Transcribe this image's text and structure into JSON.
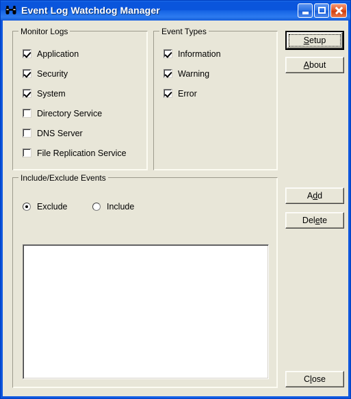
{
  "window": {
    "title": "Event Log Watchdog Manager",
    "icon": "binoculars-icon",
    "caption_buttons": {
      "minimize": "minimize-icon",
      "maximize": "maximize-icon",
      "close": "close-icon"
    },
    "colors": {
      "titlebar_blue": "#0A55DC",
      "client_background": "#E8E6D8",
      "close_button_red": "#E45A28",
      "listbox_background": "#FFFFFF"
    }
  },
  "monitor_logs": {
    "title": "Monitor Logs",
    "items": [
      {
        "label": "Application",
        "checked": true
      },
      {
        "label": "Security",
        "checked": true
      },
      {
        "label": "System",
        "checked": true
      },
      {
        "label": "Directory Service",
        "checked": false
      },
      {
        "label": "DNS Server",
        "checked": false
      },
      {
        "label": "File Replication Service",
        "checked": false
      }
    ]
  },
  "event_types": {
    "title": "Event Types",
    "items": [
      {
        "label": "Information",
        "checked": true
      },
      {
        "label": "Warning",
        "checked": true
      },
      {
        "label": "Error",
        "checked": true
      }
    ]
  },
  "include_exclude": {
    "title": "Include/Exclude Events",
    "options": [
      {
        "label": "Exclude",
        "selected": true
      },
      {
        "label": "Include",
        "selected": false
      }
    ],
    "listbox_items": []
  },
  "buttons": {
    "setup": {
      "label": "Setup",
      "mnemonic": "S",
      "is_default": true
    },
    "about": {
      "label": "About",
      "mnemonic": "A",
      "is_default": false
    },
    "add": {
      "label": "Add",
      "mnemonic": "d",
      "is_default": false
    },
    "delete": {
      "label": "Delete",
      "mnemonic": "e",
      "is_default": false
    },
    "close": {
      "label": "Close",
      "mnemonic": "l",
      "is_default": false
    }
  }
}
